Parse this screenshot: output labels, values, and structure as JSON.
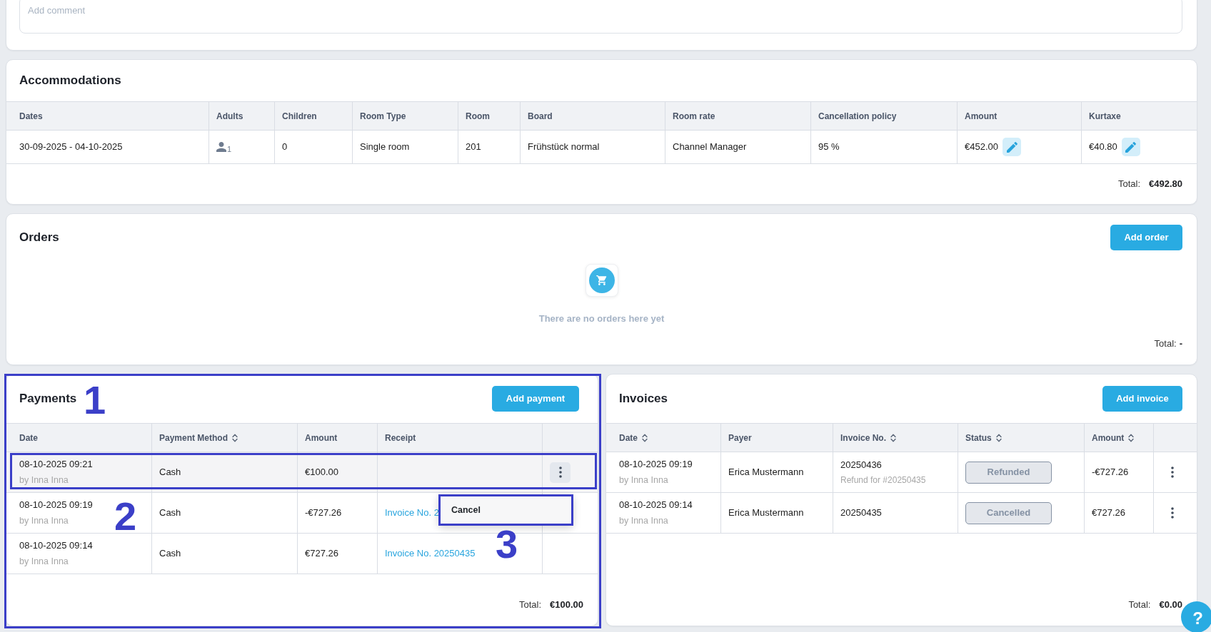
{
  "comment": {
    "placeholder": "Add comment"
  },
  "accommodations": {
    "title": "Accommodations",
    "columns": [
      "Dates",
      "Adults",
      "Children",
      "Room Type",
      "Room",
      "Board",
      "Room rate",
      "Cancellation policy",
      "Amount",
      "Kurtaxe"
    ],
    "rows": [
      {
        "cells": [
          {
            "kind": "text",
            "text": "30-09-2025 - 04-10-2025"
          },
          {
            "kind": "guests",
            "text": "1"
          },
          {
            "kind": "text",
            "text": "0"
          },
          {
            "kind": "text",
            "text": "Single room"
          },
          {
            "kind": "text",
            "text": "201"
          },
          {
            "kind": "text",
            "text": "Frühstück normal"
          },
          {
            "kind": "text",
            "text": "Channel Manager"
          },
          {
            "kind": "text",
            "text": "95 %"
          },
          {
            "kind": "editable",
            "text": "€452.00"
          },
          {
            "kind": "editable",
            "text": "€40.80"
          }
        ]
      }
    ],
    "total_label": "Total:",
    "total": "€492.80"
  },
  "orders": {
    "title": "Orders",
    "add_button": "Add order",
    "empty_text": "There are no orders here yet",
    "total_label": "Total:",
    "total": "-"
  },
  "payments": {
    "title": "Payments",
    "add_button": "Add payment",
    "columns": [
      {
        "label": "Date",
        "sortable": false
      },
      {
        "label": "Payment Method",
        "sortable": true
      },
      {
        "label": "Amount",
        "sortable": false
      },
      {
        "label": "Receipt",
        "sortable": false
      }
    ],
    "rows": [
      {
        "date": "08-10-2025 09:21",
        "author": "by Inna Inna",
        "method": "Cash",
        "amount": "€100.00",
        "selected": true,
        "menu_open": true
      },
      {
        "date": "08-10-2025 09:19",
        "author": "by Inna Inna",
        "method": "Cash",
        "amount": "-€727.26",
        "receipt": "Invoice No. 2",
        "selected": false,
        "menu_open": false
      },
      {
        "date": "08-10-2025 09:14",
        "author": "by Inna Inna",
        "method": "Cash",
        "amount": "€727.26",
        "receipt": "Invoice No. 20250435",
        "selected": false,
        "menu_open": false
      }
    ],
    "row_menu": {
      "items": [
        {
          "label": "Cancel"
        }
      ]
    },
    "total_label": "Total:",
    "total": "€100.00"
  },
  "invoices": {
    "title": "Invoices",
    "add_button": "Add invoice",
    "columns": [
      {
        "label": "Date",
        "sortable": true
      },
      {
        "label": "Payer",
        "sortable": false
      },
      {
        "label": "Invoice No.",
        "sortable": true
      },
      {
        "label": "Status",
        "sortable": true
      },
      {
        "label": "Amount",
        "sortable": true
      }
    ],
    "rows": [
      {
        "date": "08-10-2025 09:19",
        "author": "by Inna Inna",
        "payer": "Erica Mustermann",
        "number": "20250436",
        "note": "Refund for #20250435",
        "status": "Refunded",
        "amount": "-€727.26"
      },
      {
        "date": "08-10-2025 09:14",
        "author": "by Inna Inna",
        "payer": "Erica Mustermann",
        "number": "20250435",
        "status": "Cancelled",
        "amount": "€727.26"
      }
    ],
    "total_label": "Total:",
    "total": "€0.00"
  },
  "annotations": [
    {
      "label": "1"
    },
    {
      "label": "2"
    },
    {
      "label": "3"
    }
  ],
  "help_button": {
    "label": "?"
  }
}
